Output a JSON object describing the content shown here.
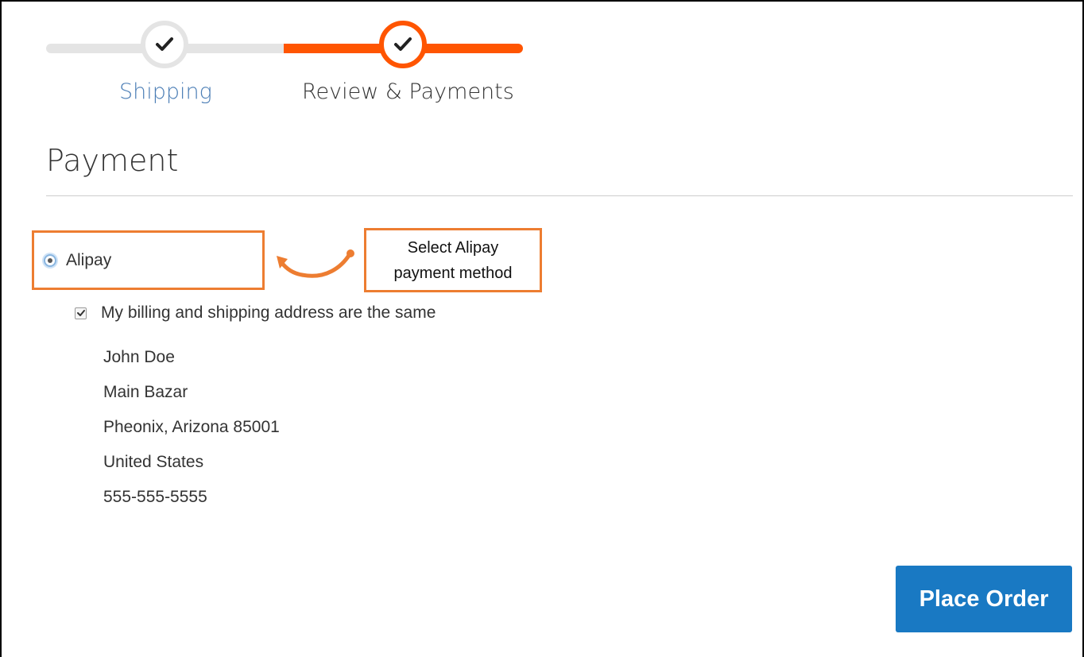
{
  "progress": {
    "steps": [
      {
        "label": "Shipping",
        "state": "complete"
      },
      {
        "label": "Review & Payments",
        "state": "active"
      }
    ]
  },
  "payment": {
    "title": "Payment",
    "method": {
      "label": "Alipay",
      "selected": true
    },
    "callout": {
      "line1": "Select Alipay",
      "line2": "payment method"
    },
    "billing_same": {
      "label": "My billing and shipping address are the same",
      "checked": true
    },
    "address": {
      "name": "John Doe",
      "street": "Main Bazar",
      "city_region_zip": "Pheonix, Arizona 85001",
      "country": "United States",
      "phone": "555-555-5555"
    }
  },
  "actions": {
    "place_order": "Place Order"
  },
  "colors": {
    "accent": "#ff5501",
    "highlight": "#ed7d31",
    "primary_button": "#1979c3",
    "link": "#4a7db5"
  }
}
